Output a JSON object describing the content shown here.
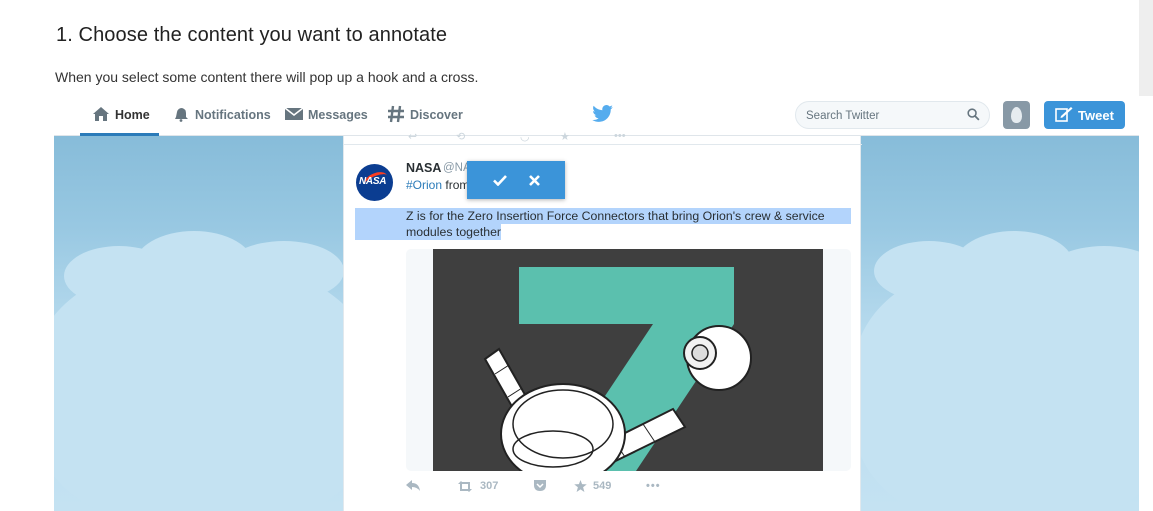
{
  "instructions": {
    "heading": "1. Choose the content you want to annotate",
    "subtext": "When you select some content there will pop up a hook and a cross."
  },
  "twitter": {
    "nav": {
      "home": "Home",
      "notifications": "Notifications",
      "messages": "Messages",
      "discover": "Discover"
    },
    "search_placeholder": "Search Twitter",
    "tweet_button": "Tweet",
    "colors": {
      "brand": "#55acee",
      "button": "#3b94d9",
      "link": "#2b7bb9",
      "selection": "#b3d4fc"
    }
  },
  "tweet": {
    "author": "NASA",
    "handle": "@NASA",
    "hashtag": "#Orion",
    "line2_rest": "from A",
    "text_line1": "Z is for the Zero Insertion Force Connectors that bring Orion's crew & service",
    "text_line2": "modules together",
    "retweets": "307",
    "likes": "549"
  },
  "popup": {
    "confirm_icon": "check-icon",
    "cancel_icon": "close-icon"
  }
}
